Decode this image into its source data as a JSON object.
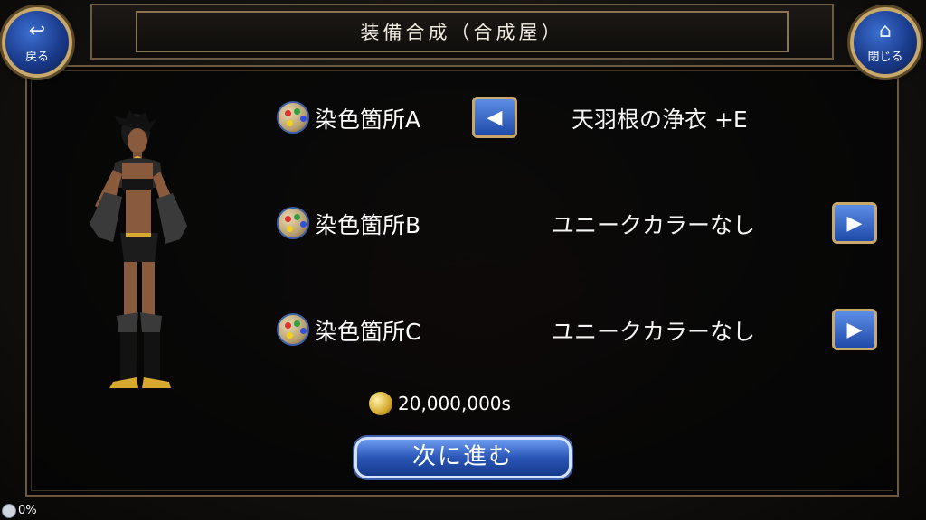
{
  "header": {
    "title": "装備合成（合成屋）"
  },
  "nav": {
    "back_label": "戻る",
    "back_icon": "back-arrow-icon",
    "close_label": "閉じる",
    "close_icon": "home-icon"
  },
  "dye_slots": [
    {
      "label": "染色箇所A",
      "value": "天羽根の浄衣 +E",
      "arrow": "◀"
    },
    {
      "label": "染色箇所B",
      "value": "ユニークカラーなし",
      "arrow": "▶"
    },
    {
      "label": "染色箇所C",
      "value": "ユニークカラーなし",
      "arrow": "▶"
    }
  ],
  "cost": {
    "amount": "20,000,000s",
    "icon": "coin-icon"
  },
  "next_button": {
    "label": "次に進む"
  },
  "loading": {
    "percent": "0%"
  },
  "colors": {
    "button_blue": "#2a56b8",
    "frame_gold": "#c9a96b",
    "panel_bg": "#050505"
  }
}
